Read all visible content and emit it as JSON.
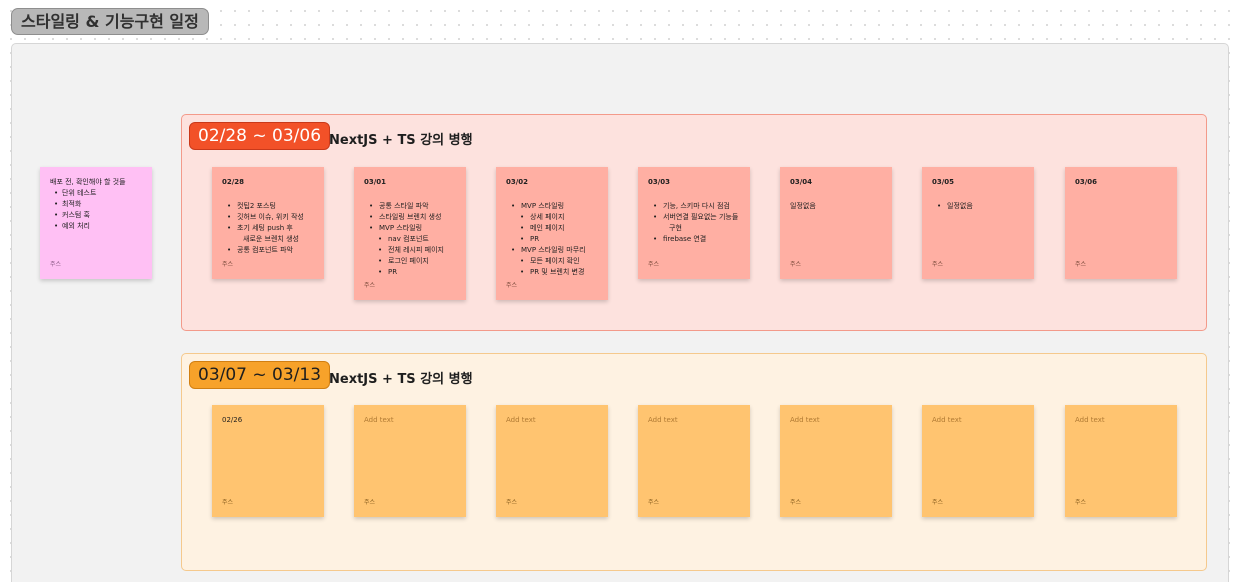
{
  "board": {
    "title": "스타일링 & 기능구현 일정"
  },
  "side_note": {
    "text": "배포 전, 확인해야 할 것들",
    "items": [
      "단위 테스트",
      "최적화",
      "커스텀 훅",
      "예외 처리"
    ],
    "author": "주스"
  },
  "week1": {
    "badge": "02/28 ~ 03/06",
    "title": "NextJS + TS 강의 병행",
    "color": "#f25128",
    "notes": [
      {
        "date": "02/28",
        "author": "주스",
        "items": [
          "컷팁2 포스팅",
          "깃허브 이슈, 위키 작성",
          "초기 세팅 push 후",
          "공통 컴포넌트 파악"
        ],
        "continuation": "새로운 브렌치 생성"
      },
      {
        "date": "03/01",
        "author": "주스",
        "items": [
          "공통 스타일 파악",
          "스타일링 브렌치 생성",
          "MVP 스타일링"
        ],
        "subitems": [
          "nav 컴포넌트",
          "전체 레시피  페이지",
          "로그인 페이지",
          "PR"
        ]
      },
      {
        "date": "03/02",
        "author": "주스",
        "items": [
          "MVP 스타일링",
          "MVP 스타일링 마무리"
        ],
        "subitems_a": [
          "상세 페이지",
          "메인 페이지",
          "PR"
        ],
        "subitems_b": [
          "모든 페이지 확인",
          "PR 및 브렌치 변경"
        ]
      },
      {
        "date": "03/03",
        "author": "주스",
        "items": [
          "기능, 스키마 다시 점검",
          "서버연결 필요없는 기능들",
          "firebase 연결"
        ],
        "continuation": "구현"
      },
      {
        "date": "03/04",
        "author": "주스",
        "text": "일정없음"
      },
      {
        "date": "03/05",
        "author": "주스",
        "items": [
          "일정없음"
        ]
      },
      {
        "date": "03/06",
        "author": "주스"
      }
    ]
  },
  "week2": {
    "badge": "03/07 ~ 03/13",
    "title": "NextJS + TS 강의 병행",
    "color": "#f7a22a",
    "notes": [
      {
        "text": "02/26",
        "author": "주스"
      },
      {
        "text": "Add text",
        "author": "주스"
      },
      {
        "text": "Add text",
        "author": "주스"
      },
      {
        "text": "Add text",
        "author": "주스"
      },
      {
        "text": "Add text",
        "author": "주스"
      },
      {
        "text": "Add text",
        "author": "주스"
      },
      {
        "text": "Add text",
        "author": "주스"
      }
    ]
  }
}
